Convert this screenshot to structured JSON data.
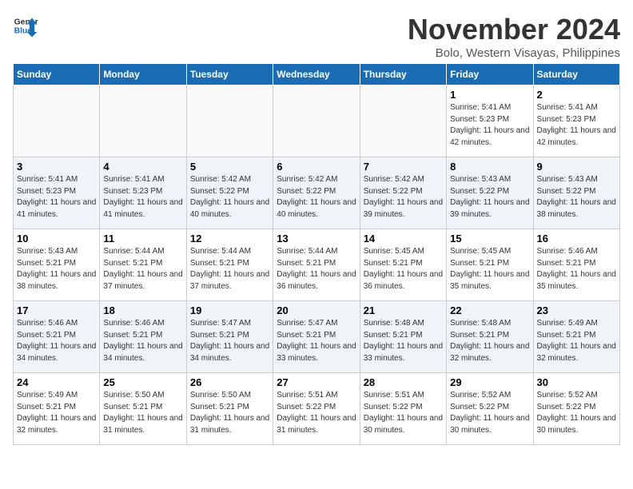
{
  "logo": {
    "line1": "General",
    "line2": "Blue"
  },
  "title": "November 2024",
  "subtitle": "Bolo, Western Visayas, Philippines",
  "headers": [
    "Sunday",
    "Monday",
    "Tuesday",
    "Wednesday",
    "Thursday",
    "Friday",
    "Saturday"
  ],
  "weeks": [
    [
      {
        "day": "",
        "info": ""
      },
      {
        "day": "",
        "info": ""
      },
      {
        "day": "",
        "info": ""
      },
      {
        "day": "",
        "info": ""
      },
      {
        "day": "",
        "info": ""
      },
      {
        "day": "1",
        "info": "Sunrise: 5:41 AM\nSunset: 5:23 PM\nDaylight: 11 hours and 42 minutes."
      },
      {
        "day": "2",
        "info": "Sunrise: 5:41 AM\nSunset: 5:23 PM\nDaylight: 11 hours and 42 minutes."
      }
    ],
    [
      {
        "day": "3",
        "info": "Sunrise: 5:41 AM\nSunset: 5:23 PM\nDaylight: 11 hours and 41 minutes."
      },
      {
        "day": "4",
        "info": "Sunrise: 5:41 AM\nSunset: 5:23 PM\nDaylight: 11 hours and 41 minutes."
      },
      {
        "day": "5",
        "info": "Sunrise: 5:42 AM\nSunset: 5:22 PM\nDaylight: 11 hours and 40 minutes."
      },
      {
        "day": "6",
        "info": "Sunrise: 5:42 AM\nSunset: 5:22 PM\nDaylight: 11 hours and 40 minutes."
      },
      {
        "day": "7",
        "info": "Sunrise: 5:42 AM\nSunset: 5:22 PM\nDaylight: 11 hours and 39 minutes."
      },
      {
        "day": "8",
        "info": "Sunrise: 5:43 AM\nSunset: 5:22 PM\nDaylight: 11 hours and 39 minutes."
      },
      {
        "day": "9",
        "info": "Sunrise: 5:43 AM\nSunset: 5:22 PM\nDaylight: 11 hours and 38 minutes."
      }
    ],
    [
      {
        "day": "10",
        "info": "Sunrise: 5:43 AM\nSunset: 5:21 PM\nDaylight: 11 hours and 38 minutes."
      },
      {
        "day": "11",
        "info": "Sunrise: 5:44 AM\nSunset: 5:21 PM\nDaylight: 11 hours and 37 minutes."
      },
      {
        "day": "12",
        "info": "Sunrise: 5:44 AM\nSunset: 5:21 PM\nDaylight: 11 hours and 37 minutes."
      },
      {
        "day": "13",
        "info": "Sunrise: 5:44 AM\nSunset: 5:21 PM\nDaylight: 11 hours and 36 minutes."
      },
      {
        "day": "14",
        "info": "Sunrise: 5:45 AM\nSunset: 5:21 PM\nDaylight: 11 hours and 36 minutes."
      },
      {
        "day": "15",
        "info": "Sunrise: 5:45 AM\nSunset: 5:21 PM\nDaylight: 11 hours and 35 minutes."
      },
      {
        "day": "16",
        "info": "Sunrise: 5:46 AM\nSunset: 5:21 PM\nDaylight: 11 hours and 35 minutes."
      }
    ],
    [
      {
        "day": "17",
        "info": "Sunrise: 5:46 AM\nSunset: 5:21 PM\nDaylight: 11 hours and 34 minutes."
      },
      {
        "day": "18",
        "info": "Sunrise: 5:46 AM\nSunset: 5:21 PM\nDaylight: 11 hours and 34 minutes."
      },
      {
        "day": "19",
        "info": "Sunrise: 5:47 AM\nSunset: 5:21 PM\nDaylight: 11 hours and 34 minutes."
      },
      {
        "day": "20",
        "info": "Sunrise: 5:47 AM\nSunset: 5:21 PM\nDaylight: 11 hours and 33 minutes."
      },
      {
        "day": "21",
        "info": "Sunrise: 5:48 AM\nSunset: 5:21 PM\nDaylight: 11 hours and 33 minutes."
      },
      {
        "day": "22",
        "info": "Sunrise: 5:48 AM\nSunset: 5:21 PM\nDaylight: 11 hours and 32 minutes."
      },
      {
        "day": "23",
        "info": "Sunrise: 5:49 AM\nSunset: 5:21 PM\nDaylight: 11 hours and 32 minutes."
      }
    ],
    [
      {
        "day": "24",
        "info": "Sunrise: 5:49 AM\nSunset: 5:21 PM\nDaylight: 11 hours and 32 minutes."
      },
      {
        "day": "25",
        "info": "Sunrise: 5:50 AM\nSunset: 5:21 PM\nDaylight: 11 hours and 31 minutes."
      },
      {
        "day": "26",
        "info": "Sunrise: 5:50 AM\nSunset: 5:21 PM\nDaylight: 11 hours and 31 minutes."
      },
      {
        "day": "27",
        "info": "Sunrise: 5:51 AM\nSunset: 5:22 PM\nDaylight: 11 hours and 31 minutes."
      },
      {
        "day": "28",
        "info": "Sunrise: 5:51 AM\nSunset: 5:22 PM\nDaylight: 11 hours and 30 minutes."
      },
      {
        "day": "29",
        "info": "Sunrise: 5:52 AM\nSunset: 5:22 PM\nDaylight: 11 hours and 30 minutes."
      },
      {
        "day": "30",
        "info": "Sunrise: 5:52 AM\nSunset: 5:22 PM\nDaylight: 11 hours and 30 minutes."
      }
    ]
  ]
}
